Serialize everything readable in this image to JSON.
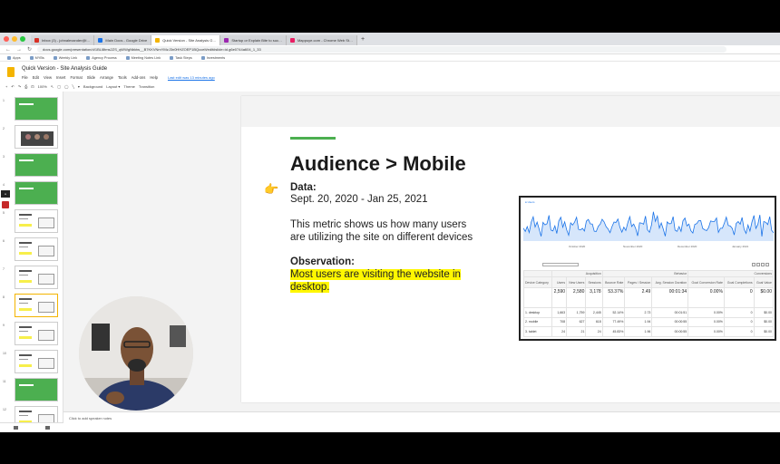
{
  "browser": {
    "tabs": [
      {
        "label": "Inbox (3) - johnalexander@l…",
        "color": "#d93025"
      },
      {
        "label": "Main Docs - Google Drive",
        "color": "#1a73e8"
      },
      {
        "label": "Quick Version - Site Analysis G…",
        "color": "#f4b400"
      },
      {
        "label": "Startup or Explain Bite to suc…",
        "color": "#9c27b0"
      },
      {
        "label": "Mappuye.com - Chrome Web St…",
        "color": "#e91e63"
      }
    ],
    "url": "docs.google.com/presentation/d/1BLl8tms2ZS_qWWgNbktw__B7KKVNmYMzJ3n0HHZOEP1BQcceIt/edit#slide=id.g6e0744a604_1_33",
    "bookmarks": [
      "Apps",
      "MYBs",
      "Weekly Link",
      "Agency Process",
      "Meeting Notes Link",
      "Task Steps",
      "Investments"
    ]
  },
  "app": {
    "title": "Quick Version - Site Analysis Guide",
    "menus": [
      "File",
      "Edit",
      "View",
      "Insert",
      "Format",
      "Slide",
      "Arrange",
      "Tools",
      "Add-ons",
      "Help"
    ],
    "last_edit": "Last edit was 13 minutes ago",
    "toolbar": [
      "+",
      "↶",
      "↷",
      "⎙",
      "⊡",
      "100%",
      "↖",
      "▢",
      "◯",
      "╲",
      "▾",
      "Background",
      "Layout ▾",
      "Theme",
      "Transition"
    ]
  },
  "filmstrip": {
    "slides": [
      {
        "num": "1",
        "kind": "green"
      },
      {
        "num": "2",
        "kind": "photo"
      },
      {
        "num": "3",
        "kind": "green"
      },
      {
        "num": "4",
        "kind": "green"
      },
      {
        "num": "5",
        "kind": "content"
      },
      {
        "num": "6",
        "kind": "content"
      },
      {
        "num": "7",
        "kind": "content"
      },
      {
        "num": "8",
        "kind": "content",
        "selected": true
      },
      {
        "num": "9",
        "kind": "content"
      },
      {
        "num": "10",
        "kind": "content"
      },
      {
        "num": "11",
        "kind": "green"
      },
      {
        "num": "12",
        "kind": "content"
      }
    ]
  },
  "slide": {
    "title": "Audience > Mobile",
    "data_label": "Data:",
    "data_value": "Sept. 20, 2020 - Jan 25, 2021",
    "description_line1": "This metric shows us how many users",
    "description_line2": "are utilizing the site on different devices",
    "observation_label": "Observation:",
    "observation_line1": "Most users are visiting the website in",
    "observation_line2": "desktop.",
    "accent_color": "#4caf50",
    "highlight_color": "#fff700"
  },
  "analytics": {
    "legend": "● Users",
    "table_headers": [
      "Device Category",
      "Users",
      "New Users",
      "Sessions",
      "Bounce Rate",
      "Pages / Session",
      "Avg. Session Duration",
      "Goal Conversion Rate",
      "Goal Completions",
      "Goal Value"
    ],
    "totals": [
      "",
      "2,590",
      "2,580",
      "3,178",
      "53.37%",
      "2.49",
      "00:01:34",
      "0.00%",
      "0",
      "$0.00"
    ],
    "rows": [
      [
        "1. desktop",
        "1,663",
        "1,759",
        "2,445",
        "52.14%",
        "2.73",
        "00:01:51",
        "0.00%",
        "0",
        "$0.00"
      ],
      [
        "2. mobile",
        "708",
        "627",
        "618",
        "77.49%",
        "1.94",
        "00:00:55",
        "0.00%",
        "0",
        "$0.00"
      ],
      [
        "3. tablet",
        "24",
        "21",
        "24",
        "45.83%",
        "1.96",
        "00:00:55",
        "0.00%",
        "0",
        "$0.00"
      ]
    ],
    "x_ticks": [
      "October 2020",
      "November 2020",
      "December 2020",
      "January 2021"
    ],
    "series_color": "#1a73e8"
  },
  "notes": {
    "placeholder": "Click to add speaker notes"
  }
}
